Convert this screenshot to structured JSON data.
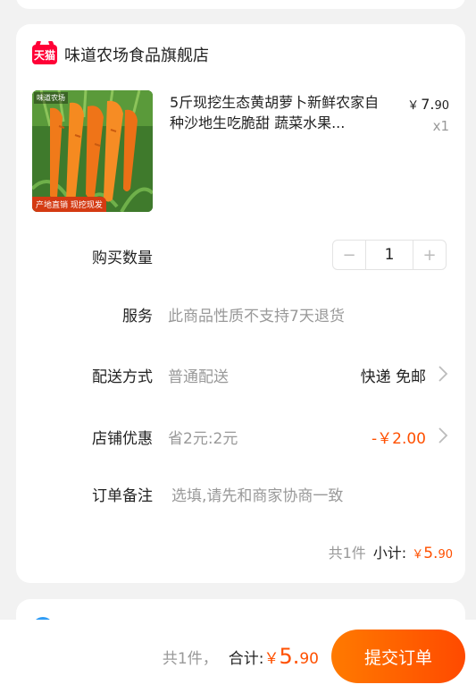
{
  "shop": {
    "badge": "天猫",
    "name": "味道农场食品旗舰店"
  },
  "product": {
    "image_label_top": "味道农场",
    "image_label_bottom": "产地直销 现挖现发",
    "title": "5斤现挖生态黄胡萝卜新鲜农家自种沙地生吃脆甜 蔬菜水果...",
    "price_currency": "￥",
    "price_int": "7.",
    "price_dec": "90",
    "quantity": "x1"
  },
  "rows": {
    "quantity_label": "购买数量",
    "quantity_value": "1",
    "minus": "−",
    "plus": "+",
    "service_label": "服务",
    "service_value": "此商品性质不支持7天退货",
    "delivery_label": "配送方式",
    "delivery_value": "普通配送",
    "delivery_right": "快递 免邮",
    "discount_label": "店铺优惠",
    "discount_value": "省2元:2元",
    "discount_right": "-￥2.00",
    "note_label": "订单备注",
    "note_placeholder": "选填,请先和商家协商一致"
  },
  "subtotal": {
    "count": "共1件",
    "label": "小计:",
    "currency": "￥",
    "int": "5.",
    "dec": "90"
  },
  "footer": {
    "count": "共1件，",
    "label": "合计:",
    "currency": "￥",
    "int": "5.",
    "dec": "90",
    "submit": "提交订单"
  },
  "colors": {
    "accent": "#ff5000",
    "tmall": "#ff0036"
  }
}
